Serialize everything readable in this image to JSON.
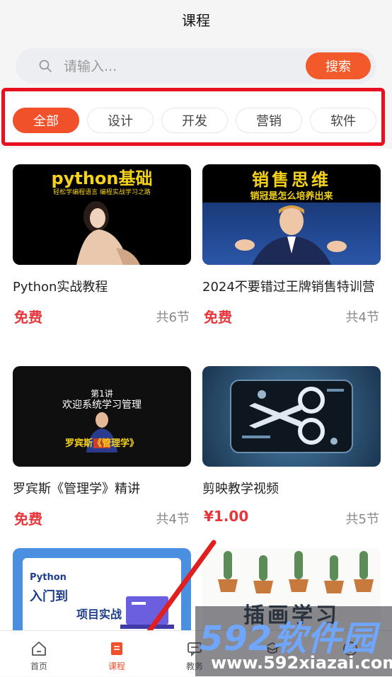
{
  "header": {
    "title": "课程"
  },
  "search": {
    "placeholder": "请输入...",
    "button_label": "搜索"
  },
  "categories": [
    {
      "label": "全部",
      "active": true
    },
    {
      "label": "设计",
      "active": false
    },
    {
      "label": "开发",
      "active": false
    },
    {
      "label": "营销",
      "active": false
    },
    {
      "label": "软件",
      "active": false
    }
  ],
  "courses": [
    {
      "title": "Python实战教程",
      "price": "免费",
      "lessons": "共6节",
      "thumb_headline": "python基础",
      "thumb_subline": "轻松学编程语言 编程实战学习之路"
    },
    {
      "title": "2024不要错过王牌销售特训营",
      "price": "免费",
      "lessons": "共4节",
      "thumb_headline": "销售思维",
      "thumb_subline": "销冠是怎么培养出来"
    },
    {
      "title": "罗宾斯《管理学》精讲",
      "price": "免费",
      "lessons": "共4节",
      "thumb_headline": "第1讲",
      "thumb_line2": "欢迎系统学习管理",
      "thumb_caption": "罗宾斯《管理学》"
    },
    {
      "title": "剪映教学视频",
      "price": "¥1.00",
      "lessons": "共5节"
    },
    {
      "thumb_headline": "Python",
      "thumb_line2": "入门到",
      "thumb_line3": "项目实战"
    },
    {
      "thumb_headline": "插画学习"
    }
  ],
  "tabbar": [
    {
      "label": "首页",
      "icon": "home-icon",
      "active": false
    },
    {
      "label": "课程",
      "icon": "course-icon",
      "active": true
    },
    {
      "label": "教务",
      "icon": "chat-icon",
      "active": false
    },
    {
      "label": "",
      "icon": "graduation-icon",
      "active": false
    },
    {
      "label": "",
      "icon": "smile-icon",
      "active": false
    }
  ],
  "watermark": {
    "main": "592软件园",
    "sub": "www.592xiazai.com"
  },
  "colors": {
    "accent": "#f0502a",
    "price_red": "#e8353a",
    "highlight_border": "#e8101e"
  }
}
